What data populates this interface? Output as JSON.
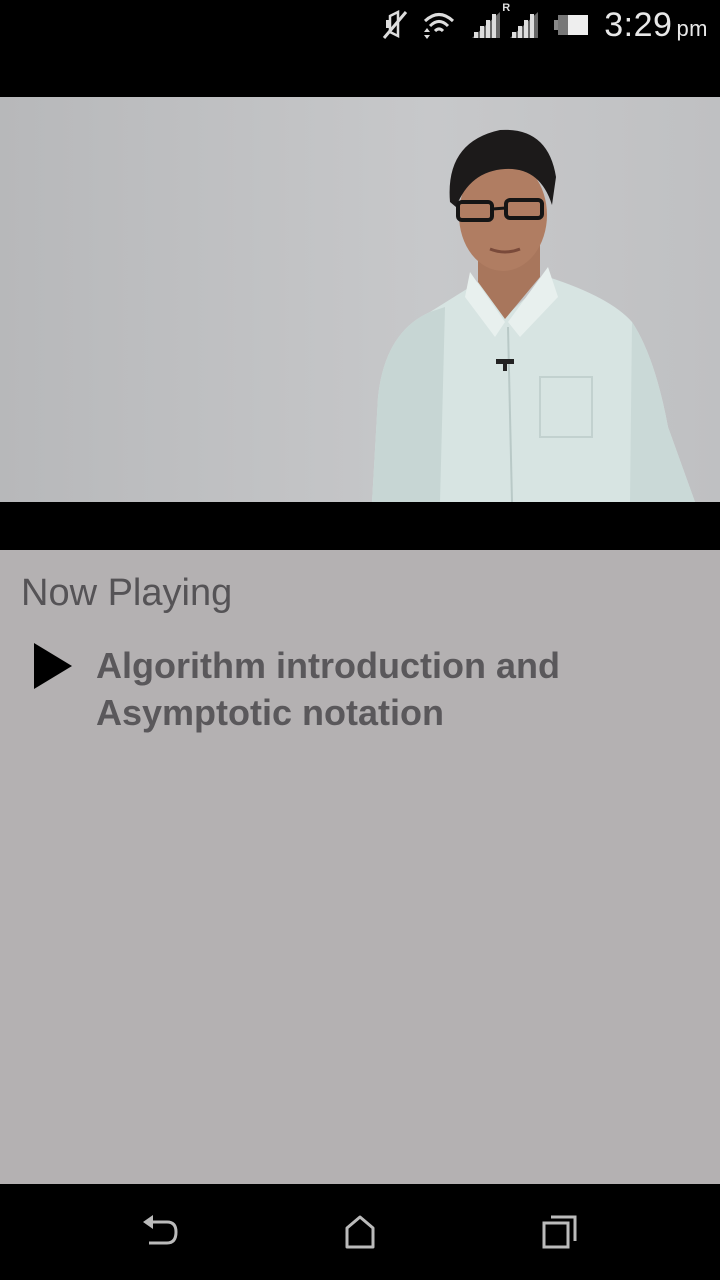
{
  "status_bar": {
    "time": "3:29",
    "ampm": "pm",
    "icons": [
      "mute-icon",
      "wifi-icon",
      "signal-icon",
      "roaming-signal-icon",
      "battery-icon"
    ],
    "roaming_label": "R"
  },
  "video": {
    "description_icon": "video-frame"
  },
  "now_playing": {
    "heading": "Now Playing",
    "items": [
      {
        "title": "Algorithm introduction and Asymptotic notation",
        "icon": "play-icon"
      }
    ]
  },
  "nav_bar": {
    "buttons": [
      "back-icon",
      "home-icon",
      "recents-icon"
    ]
  },
  "colors": {
    "panel_bg": "#b4b1b2",
    "text": "#5a585b",
    "bars": "#000000"
  }
}
